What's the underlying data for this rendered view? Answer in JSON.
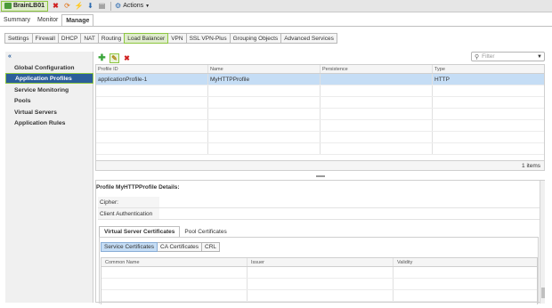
{
  "window": {
    "title": "BrainLB01",
    "actions_label": "Actions"
  },
  "main_tabs": [
    {
      "label": "Summary"
    },
    {
      "label": "Monitor"
    },
    {
      "label": "Manage"
    }
  ],
  "sub_tabs": [
    {
      "label": "Settings"
    },
    {
      "label": "Firewall"
    },
    {
      "label": "DHCP"
    },
    {
      "label": "NAT"
    },
    {
      "label": "Routing"
    },
    {
      "label": "Load Balancer"
    },
    {
      "label": "VPN"
    },
    {
      "label": "SSL VPN-Plus"
    },
    {
      "label": "Grouping Objects"
    },
    {
      "label": "Advanced Services"
    }
  ],
  "sidebar": {
    "items": [
      {
        "label": "Global Configuration"
      },
      {
        "label": "Application Profiles"
      },
      {
        "label": "Service Monitoring"
      },
      {
        "label": "Pools"
      },
      {
        "label": "Virtual Servers"
      },
      {
        "label": "Application Rules"
      }
    ]
  },
  "filter": {
    "placeholder": "Filter"
  },
  "grid": {
    "columns": [
      "Profile ID",
      "Name",
      "Persistence",
      "Type"
    ],
    "rows": [
      {
        "profile_id": "applicationProfile-1",
        "name": "MyHTTPProfile",
        "persistence": "",
        "type": "HTTP"
      }
    ],
    "footer": "1 items"
  },
  "details": {
    "title": "Profile MyHTTPProfile Details:",
    "fields": [
      {
        "label": "Cipher:",
        "value": ""
      },
      {
        "label": "Client Authentication",
        "value": ""
      }
    ],
    "cert_tabs": [
      {
        "label": "Virtual Server Certificates"
      },
      {
        "label": "Pool Certificates"
      }
    ],
    "cert_buttons": [
      {
        "label": "Service Certificates"
      },
      {
        "label": "CA Certificates"
      },
      {
        "label": "CRL"
      }
    ],
    "cert_columns": [
      "Common Name",
      "Issuer",
      "Validity"
    ]
  },
  "colors": {
    "highlight_green": "#8cc63f",
    "selection_blue": "#c5ddf5",
    "nav_active_blue": "#2b5e9a"
  }
}
